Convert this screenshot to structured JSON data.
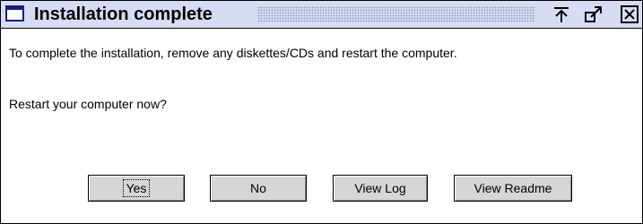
{
  "window": {
    "title": "Installation complete",
    "system_menu_icon": "window-menu-icon",
    "controls": {
      "minimize_icon": "minimize-icon",
      "restore_icon": "restore-icon",
      "close_icon": "close-icon"
    }
  },
  "message": {
    "line1": "To complete the installation, remove any diskettes/CDs and restart the computer.",
    "line2": "Restart your computer now?"
  },
  "buttons": {
    "yes": "Yes",
    "no": "No",
    "view_log": "View Log",
    "view_readme": "View Readme"
  },
  "colors": {
    "titlebar": "#d7dcf4",
    "button_face": "#d6d6d6",
    "border": "#000000"
  }
}
